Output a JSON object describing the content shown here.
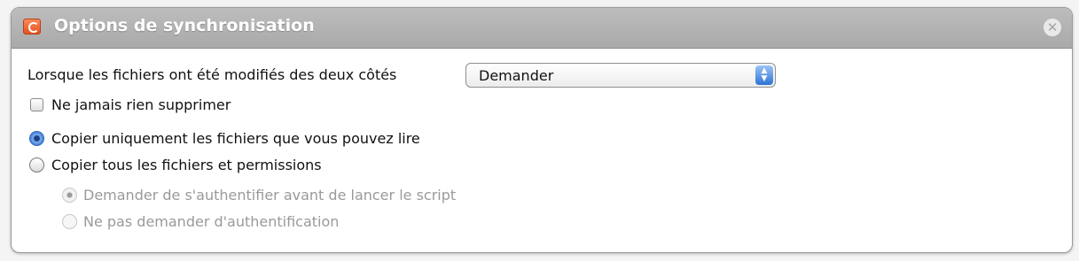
{
  "window": {
    "title": "Options de synchronisation",
    "icon": "app-icon",
    "close_icon": "close-icon"
  },
  "conflict": {
    "label": "Lorsque les fichiers ont été modifiés des deux côtés",
    "selected": "Demander"
  },
  "never_delete": {
    "label": "Ne jamais rien supprimer",
    "checked": false
  },
  "copy_mode": {
    "options": [
      {
        "label": "Copier uniquement les fichiers que vous pouvez lire",
        "selected": true
      },
      {
        "label": "Copier tous les fichiers et permissions",
        "selected": false
      }
    ]
  },
  "auth_mode": {
    "enabled": false,
    "options": [
      {
        "label": "Demander de s'authentifier avant de lancer le script",
        "selected": true
      },
      {
        "label": "Ne pas demander d'authentification",
        "selected": false
      }
    ]
  },
  "colors": {
    "header": "#b5b5b5",
    "accent": "#3a7ad8",
    "disabled_text": "#9a9a9a"
  }
}
